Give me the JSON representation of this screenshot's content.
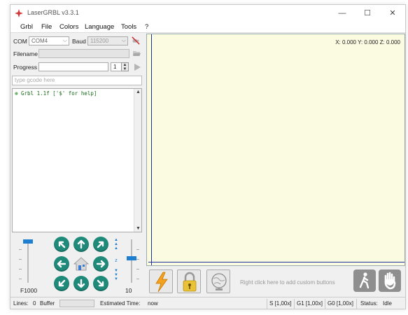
{
  "window": {
    "title": "LaserGRBL v3.3.1",
    "min_glyph": "—",
    "max_glyph": "☐",
    "close_glyph": "✕"
  },
  "menu": [
    "Grbl",
    "File",
    "Colors",
    "Language",
    "Tools",
    "?"
  ],
  "connection": {
    "com_label": "COM",
    "com_value": "COM4",
    "baud_label": "Baud",
    "baud_value": "115200"
  },
  "filename_label": "Filename",
  "progress_label": "Progress",
  "progress_count": "1",
  "gcode_placeholder": "type gcode here",
  "console_line": "Grbl 1.1f ['$' for help]",
  "jog": {
    "speed_label": "F1000",
    "step_label": "10",
    "z_letters": [
      "z"
    ]
  },
  "coords": "X: 0.000 Y: 0.000 Z: 0.000",
  "toolbar_hint": "Right click here to add custom buttons",
  "status": {
    "lines_label": "Lines:",
    "lines_value": "0",
    "buffer_label": "Buffer",
    "estimated_label": "Estimated Time:",
    "estimated_value": "now",
    "s_override": "S [1,00x]",
    "g1_override": "G1 [1,00x]",
    "g0_override": "G0 [1,00x]",
    "status_label": "Status:",
    "status_value": "Idle"
  },
  "colors": {
    "canvas_bg": "#fbfbe2",
    "axis": "#1f2f9e",
    "jog_button": "#1f8a7a",
    "slider_thumb": "#1e7fd0",
    "console_text": "#1a6b1a"
  },
  "icons": {
    "app": "laser-star-icon",
    "connect": "connect-plug-icon",
    "open_file": "open-file-icon",
    "run": "play-icon",
    "reset": "lightning-reset-icon",
    "unlock": "padlock-icon",
    "homing": "globe-homing-icon",
    "walk": "walking-person-icon",
    "stop": "hand-stop-icon"
  }
}
